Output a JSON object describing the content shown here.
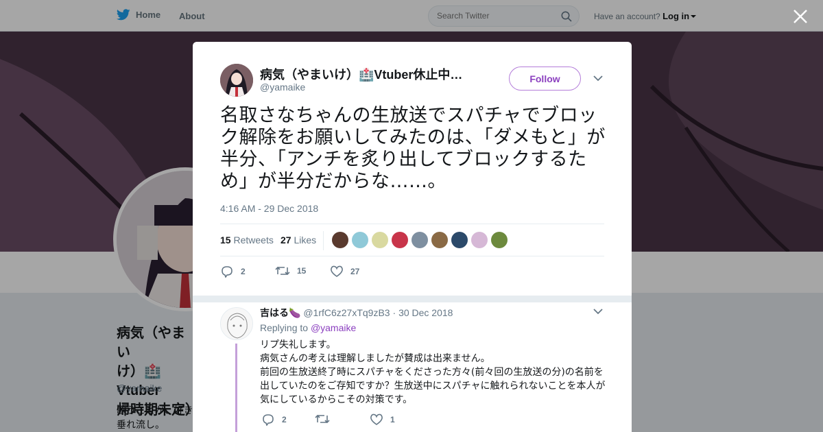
{
  "nav": {
    "home_label": "Home",
    "about_label": "About",
    "search_placeholder": "Search Twitter",
    "account_prompt": "Have an account?",
    "login_label": "Log in"
  },
  "profile": {
    "name": "病気（やまいけ）🏥Vtuber休止中（復帰時期未定）",
    "name_visible_lines": [
      "病気（やまい",
      "け）🏥Vtuber",
      "帰時期未定）"
    ],
    "handle": "@yamaike",
    "bio": "歌うことが、好き… 垂れ流し。",
    "bio_visible_lines": [
      "歌うことが、好き",
      "垂れ流し。"
    ]
  },
  "tweet": {
    "author_name": "病気（やまいけ）🏥Vtuber休止中…",
    "author_handle": "@yamaike",
    "follow_label": "Follow",
    "text": "名取さなちゃんの生放送でスパチャでブロック解除をお願いしてみたのは、「ダメもと」が半分、「アンチを炙り出してブロックするため」が半分だからな……。",
    "timestamp": "4:16 AM - 29 Dec 2018",
    "retweets_count": "15",
    "retweets_label": "Retweets",
    "likes_count": "27",
    "likes_label": "Likes",
    "reply_count": "2",
    "retweet_action_count": "15",
    "like_action_count": "27"
  },
  "reply": {
    "author_name": "吉はる🍆",
    "author_handle": "@1rfC6z27xTq9zB3",
    "separator": "·",
    "date": "30 Dec 2018",
    "replying_to_label": "Replying to",
    "replying_to_handle": "@yamaike",
    "lines": [
      "リプ失礼します。",
      "病気さんの考えは理解しましたが賛成は出来ません。",
      "前回の生放送終了時にスパチャをくださった方々(前々回の生放送の分)の名前を出していたのをご存知ですか？生放送中にスパチャに触れられないことを本人が気にしているからこその対策です。"
    ],
    "reply_count": "2",
    "retweet_count": "",
    "like_count": "1"
  },
  "colors": {
    "accent": "#8b3fbf",
    "follow_border": "#b37cd9",
    "thread_line": "#c49fd9",
    "twitter_blue": "#1da1f2",
    "muted": "#657786"
  },
  "liker_colors": [
    "#5a3a2e",
    "#8fc9d8",
    "#d9d9a0",
    "#c8354a",
    "#7e8fa0",
    "#8a6a45",
    "#2c4a6a",
    "#d6b8d6",
    "#6d8a3e"
  ]
}
